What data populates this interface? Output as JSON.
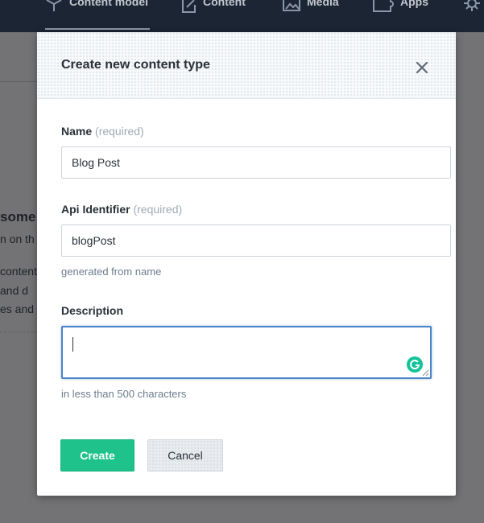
{
  "nav": {
    "items": [
      {
        "label": "Content model",
        "icon": "box-icon"
      },
      {
        "label": "Content",
        "icon": "edit-icon"
      },
      {
        "label": "Media",
        "icon": "image-icon"
      },
      {
        "label": "Apps",
        "icon": "puzzle-icon"
      },
      {
        "label": "",
        "icon": "gear-icon"
      }
    ]
  },
  "background": {
    "heading_fragment": "some",
    "line1_fragment": "n on th",
    "line2_fragment": "content",
    "line3_fragment": " and d",
    "line4_fragment": "es and"
  },
  "modal": {
    "title": "Create new content type",
    "name": {
      "label": "Name",
      "required": "(required)",
      "value": "Blog Post"
    },
    "api_identifier": {
      "label": "Api Identifier",
      "required": "(required)",
      "value": "blogPost",
      "hint": "generated from name"
    },
    "description": {
      "label": "Description",
      "value": "",
      "hint": "in less than 500 characters"
    },
    "buttons": {
      "create": "Create",
      "cancel": "Cancel"
    }
  },
  "colors": {
    "primary": "#1fc28a",
    "focus": "#4b84c8",
    "grammarly": "#15c39a",
    "nav_bg": "#1b2533"
  }
}
